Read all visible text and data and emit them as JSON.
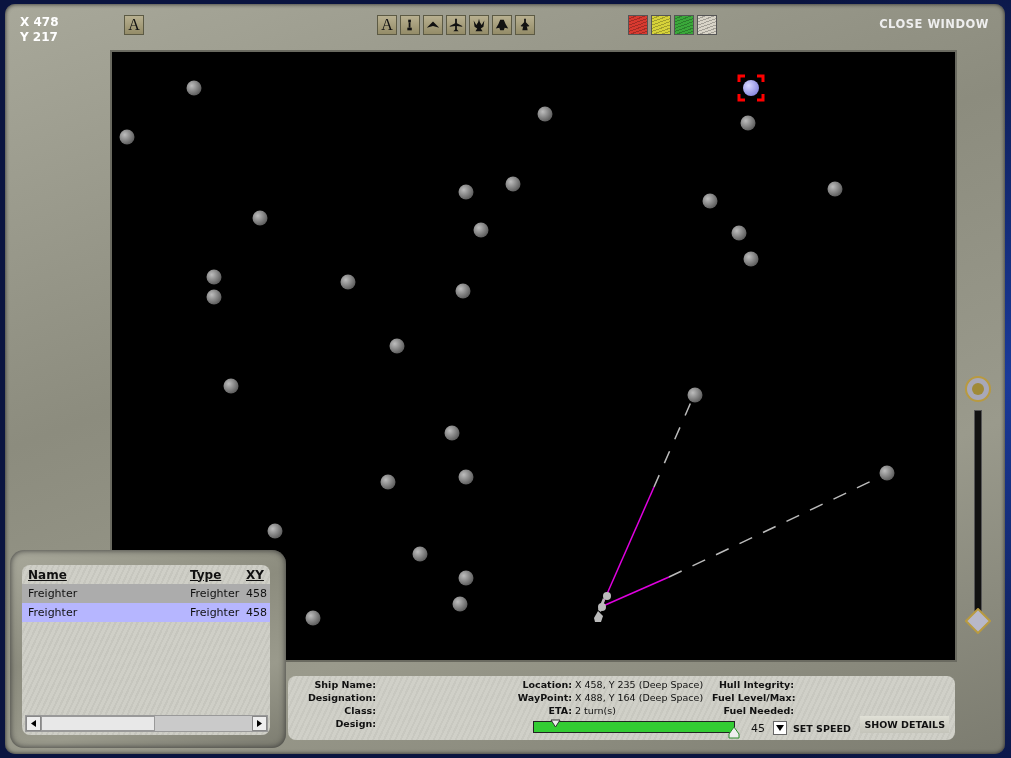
{
  "cursor": {
    "x": "X 478",
    "y": "Y 217"
  },
  "toolbar": {
    "left": [
      {
        "kind": "letter",
        "label": "A"
      }
    ],
    "views": [
      {
        "kind": "letter",
        "label": "A"
      },
      {
        "kind": "pawn"
      },
      {
        "kind": "wing"
      },
      {
        "kind": "jet"
      },
      {
        "kind": "creature"
      },
      {
        "kind": "bug"
      },
      {
        "kind": "robot"
      }
    ],
    "filters": [
      {
        "color": "#d83a30"
      },
      {
        "color": "#d6d23a"
      },
      {
        "color": "#3aa83a"
      },
      {
        "color": "#d8d4c8"
      }
    ],
    "close": "CLOSE WINDOW"
  },
  "map": {
    "stars": [
      {
        "selected": false
      },
      {
        "selected": false
      },
      {
        "selected": false
      },
      {
        "selected": false
      },
      {
        "selected": false
      },
      {
        "selected": false
      },
      {
        "selected": false
      },
      {
        "selected": false
      },
      {
        "selected": false
      },
      {
        "selected": false
      },
      {
        "selected": false
      },
      {
        "selected": false
      },
      {
        "selected": false
      },
      {
        "selected": false
      },
      {
        "selected": false
      },
      {
        "selected": false
      },
      {
        "selected": false
      },
      {
        "selected": false
      },
      {
        "selected": false
      },
      {
        "selected": false
      },
      {
        "selected": false
      },
      {
        "selected": false
      },
      {
        "selected": false
      },
      {
        "selected": false
      },
      {
        "selected": false
      },
      {
        "selected": false
      },
      {
        "selected": false
      },
      {
        "selected": false
      },
      {
        "selected": true
      }
    ]
  },
  "zoom": {
    "level": 0
  },
  "ship_list": {
    "columns": [
      "Name",
      "Type",
      "XY"
    ],
    "rows": [
      {
        "selected": false,
        "cells": [
          "Freighter",
          "Freighter",
          "458"
        ]
      },
      {
        "selected": true,
        "cells": [
          "Freighter",
          "Freighter",
          "458"
        ]
      }
    ]
  },
  "details": {
    "left": [
      {
        "label": "Ship Name:"
      },
      {
        "label": "Designation:"
      },
      {
        "label": "Class:"
      },
      {
        "label": "Design:"
      }
    ],
    "middle": [
      {
        "label": "Location:",
        "value": "X 458, Y 235 (Deep Space)"
      },
      {
        "label": "WayPoint:",
        "value": "X 488, Y 164 (Deep Space)"
      },
      {
        "label": "ETA:",
        "value": "2 turn(s)"
      }
    ],
    "right": [
      {
        "label": "Hull Integrity:"
      },
      {
        "label": "Fuel Level/Max:"
      },
      {
        "label": "Fuel Needed:"
      }
    ],
    "speed": {
      "level": 1,
      "reading": "45",
      "label": "SET SPEED"
    },
    "button": "SHOW DETAILS"
  }
}
